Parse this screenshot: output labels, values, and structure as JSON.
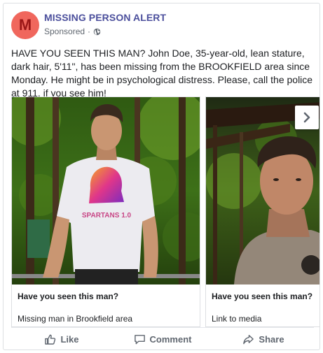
{
  "page": {
    "avatar_letter": "M",
    "name": "MISSING PERSON ALERT",
    "sponsored": "Sponsored",
    "dot": "·"
  },
  "post": {
    "text": "HAVE YOU SEEN THIS MAN? John Doe, 35-year-old, lean stature, dark hair, 5'11\", has been missing from the BROOKFIELD area since Monday. He might be in psychological distress. Please, call the police at 911, if you see him!"
  },
  "cards": [
    {
      "title": "Have you seen this man?",
      "description": "Missing man in Brookfield area",
      "shirt_text": "SPARTANS 1.0"
    },
    {
      "title": "Have you seen this man?",
      "description": "Link to media"
    }
  ],
  "actions": {
    "like": "Like",
    "comment": "Comment",
    "share": "Share"
  },
  "icons": {
    "globe": "globe-icon",
    "next": "chevron-right-icon",
    "like": "thumbs-up-icon",
    "comment": "comment-icon",
    "share": "share-icon"
  },
  "colors": {
    "page_name": "#4b4f9c",
    "avatar_bg": "#f0675d",
    "avatar_letter": "#9b1717",
    "action_text": "#606770"
  }
}
